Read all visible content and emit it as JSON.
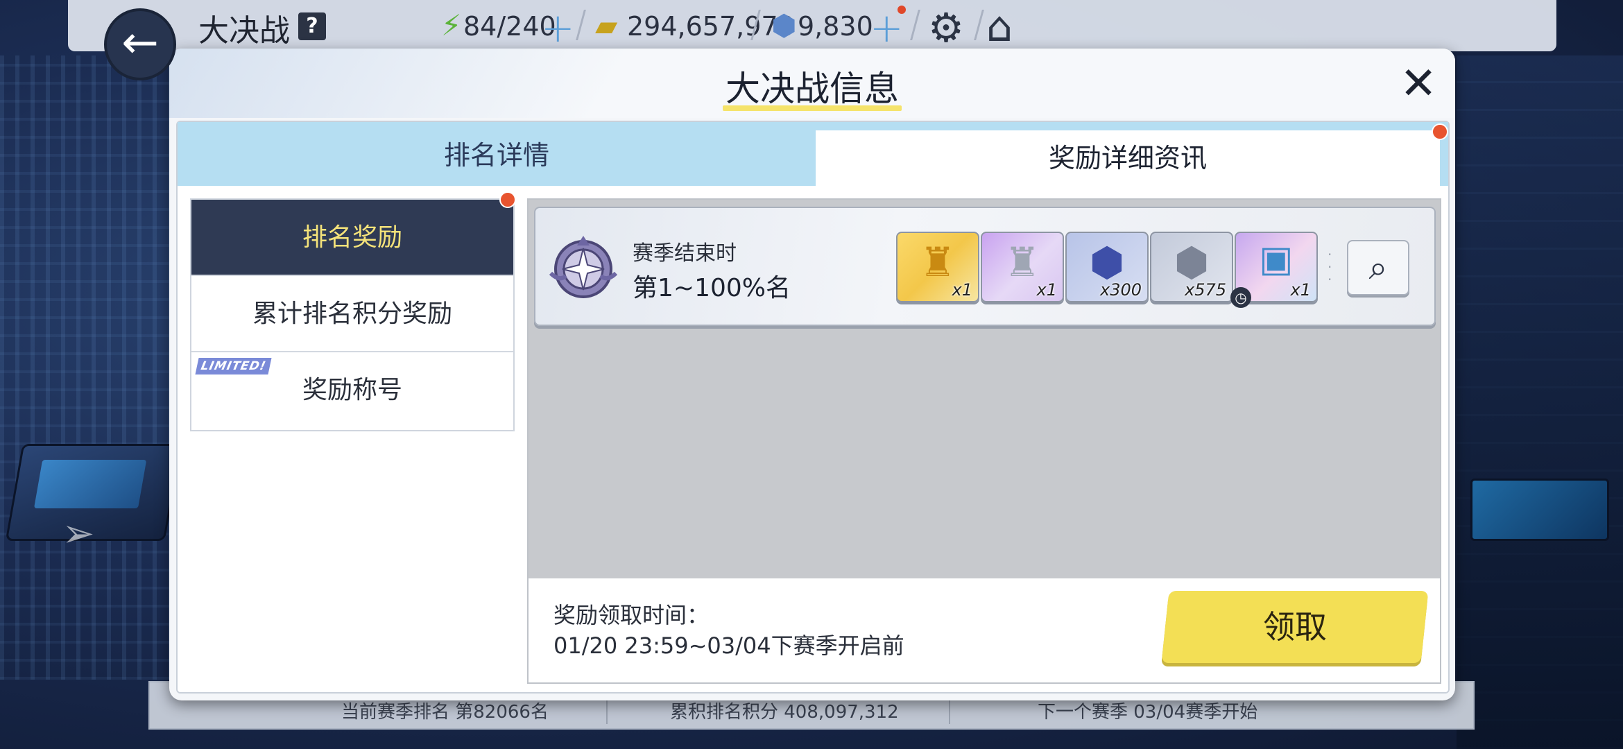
{
  "topbar": {
    "title": "大决战",
    "help_icon": "?",
    "stamina": "84/240",
    "credits": "294,657,970",
    "gems": "9,830",
    "icons": [
      "lightning-icon",
      "credit-card-icon",
      "gem-icon",
      "plus-icon",
      "gear-icon",
      "home-icon"
    ]
  },
  "background_bar": {
    "current_rank": "当前赛季排名 第82066名",
    "cumulative_points": "累积排名积分 408,097,312",
    "next_season": "下一个赛季 03/04赛季开始"
  },
  "modal": {
    "title": "大决战信息",
    "tabs": [
      {
        "label": "排名详情",
        "active": false
      },
      {
        "label": "奖励详细资讯",
        "active": true
      }
    ],
    "menu": [
      {
        "label": "排名奖励",
        "active": true
      },
      {
        "label": "累计排名积分奖励",
        "active": false
      },
      {
        "label": "奖励称号",
        "active": false,
        "badge": "LIMITED!"
      }
    ],
    "reward_row": {
      "caption": "赛季结束时",
      "rank_range": "第1~100%名",
      "items": [
        {
          "icon": "gold-trophy-icon",
          "qty": "x1"
        },
        {
          "icon": "silver-trophy-icon",
          "qty": "x1"
        },
        {
          "icon": "blue-crystal-icon",
          "qty": "x300"
        },
        {
          "icon": "silver-crystal-icon",
          "qty": "x575"
        },
        {
          "icon": "ticket-icon",
          "qty": "x1"
        }
      ]
    },
    "footer": {
      "claim_label": "奖励领取时间：",
      "claim_time": "01/20 23:59~03/04下赛季开启前",
      "claim_button": "领取"
    }
  },
  "colors": {
    "tab_bar": "#b5def2",
    "menu_active_bg": "#2f3a54",
    "menu_active_text": "#f5e37a",
    "claim_button": "#f3df55",
    "notification_dot": "#e8542f"
  }
}
